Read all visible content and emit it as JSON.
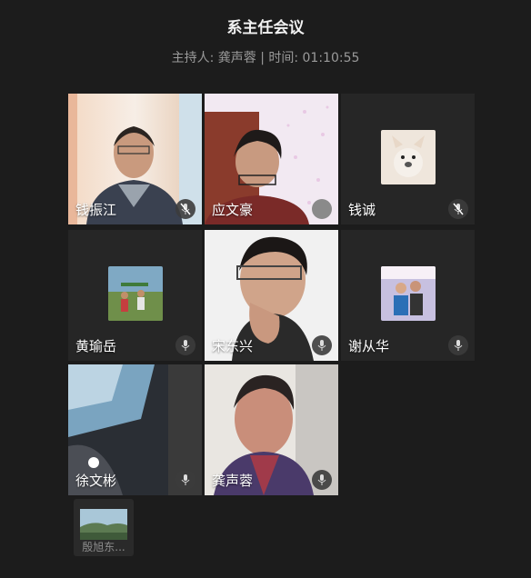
{
  "meeting": {
    "title": "系主任会议",
    "subtitle": "主持人: 龚声蓉 | 时间: 01:10:55"
  },
  "participants": [
    {
      "name": "钱振江",
      "mic": "muted-icon",
      "video": true
    },
    {
      "name": "应文豪",
      "mic": "gray-dot",
      "video": true
    },
    {
      "name": "钱诚",
      "mic": "muted-icon",
      "video": false,
      "avatar": "dog-avatar"
    },
    {
      "name": "黄瑜岳",
      "mic": "mic-icon",
      "video": false,
      "avatar": "kids-avatar"
    },
    {
      "name": "宋东兴",
      "mic": "mic-icon",
      "video": true
    },
    {
      "name": "谢从华",
      "mic": "mic-icon",
      "video": false,
      "avatar": "family-avatar"
    },
    {
      "name": "徐文彬",
      "mic": "mic-icon",
      "video": true
    },
    {
      "name": "龚声蓉",
      "mic": "mic-icon",
      "video": true
    }
  ],
  "dock": {
    "name": "殷旭东..."
  },
  "colors": {
    "background": "#1c1c1c",
    "tile": "#262626"
  }
}
